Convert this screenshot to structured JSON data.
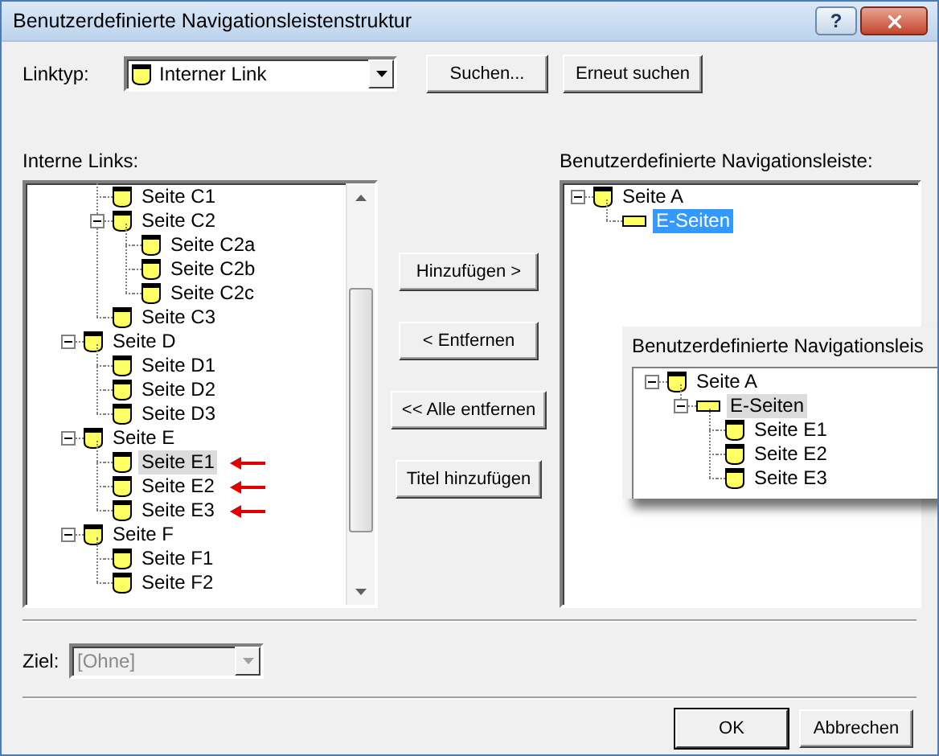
{
  "window": {
    "title": "Benutzerdefinierte Navigationsleistenstruktur",
    "help_button": "?"
  },
  "link_type": {
    "label": "Linktyp:",
    "value": "Interner Link",
    "kind": "page"
  },
  "search_buttons": [
    "Suchen...",
    "Erneut suchen"
  ],
  "internal_links": {
    "label": "Interne Links:",
    "focused": false,
    "items": [
      {
        "children": [
          {
            "label": "Seite C1",
            "kind": "page",
            "selected": false,
            "marked": false
          },
          {
            "label": "Seite C2",
            "kind": "page",
            "selected": false,
            "marked": false,
            "expanded": true,
            "children": [
              {
                "label": "Seite C2a",
                "kind": "page",
                "selected": false,
                "marked": false
              },
              {
                "label": "Seite C2b",
                "kind": "page",
                "selected": false,
                "marked": false
              },
              {
                "label": "Seite C2c",
                "kind": "page",
                "selected": false,
                "marked": false
              }
            ]
          },
          {
            "label": "Seite C3",
            "kind": "page",
            "selected": false,
            "marked": false
          }
        ]
      },
      {
        "label": "Seite D",
        "kind": "page",
        "selected": false,
        "marked": false,
        "expanded": true,
        "children": [
          {
            "label": "Seite D1",
            "kind": "page",
            "selected": false,
            "marked": false
          },
          {
            "label": "Seite D2",
            "kind": "page",
            "selected": false,
            "marked": false
          },
          {
            "label": "Seite D3",
            "kind": "page",
            "selected": false,
            "marked": false
          }
        ]
      },
      {
        "label": "Seite E",
        "kind": "page",
        "selected": false,
        "marked": false,
        "expanded": true,
        "children": [
          {
            "label": "Seite E1",
            "kind": "page",
            "selected": true,
            "marked": true
          },
          {
            "label": "Seite E2",
            "kind": "page",
            "selected": false,
            "marked": true
          },
          {
            "label": "Seite E3",
            "kind": "page",
            "selected": false,
            "marked": true
          }
        ]
      },
      {
        "label": "Seite F",
        "kind": "page",
        "selected": false,
        "marked": false,
        "expanded": true,
        "children": [
          {
            "label": "Seite F1",
            "kind": "page",
            "selected": false,
            "marked": false
          },
          {
            "label": "Seite F2",
            "kind": "page",
            "selected": false,
            "marked": false
          }
        ]
      }
    ]
  },
  "move_buttons": [
    "Hinzufügen >",
    "< Entfernen",
    "<< Alle entfernen",
    "Titel hinzufügen"
  ],
  "custom_bar": {
    "label": "Benutzerdefinierte Navigationsleiste:",
    "focused": true,
    "items": [
      {
        "label": "Seite A",
        "kind": "page",
        "selected": false,
        "expanded": true,
        "children": [
          {
            "label": "E-Seiten",
            "kind": "group",
            "selected": true
          }
        ]
      }
    ]
  },
  "preview": {
    "label": "Benutzerdefinierte Navigationsleis",
    "focused": false,
    "items": [
      {
        "label": "Seite A",
        "kind": "page",
        "selected": false,
        "expanded": true,
        "children": [
          {
            "label": "E-Seiten",
            "kind": "group",
            "selected": true,
            "expanded": true,
            "children": [
              {
                "label": "Seite E1",
                "kind": "page",
                "selected": false
              },
              {
                "label": "Seite E2",
                "kind": "page",
                "selected": false
              },
              {
                "label": "Seite E3",
                "kind": "page",
                "selected": false
              }
            ]
          }
        ]
      }
    ]
  },
  "target": {
    "label": "Ziel:",
    "value": "[Ohne]",
    "disabled": true
  },
  "buttons": [
    "OK",
    "Abbrechen"
  ]
}
